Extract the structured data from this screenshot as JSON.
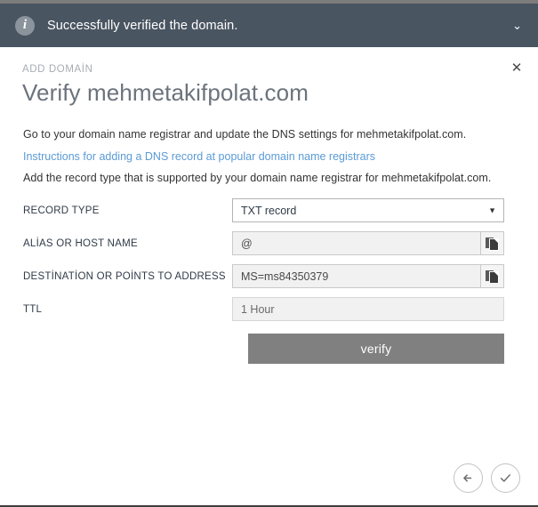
{
  "notification": {
    "icon": "info-icon",
    "message": "Successfully verified the domain.",
    "chevron": "⌄",
    "background_color": "#4a5562"
  },
  "panel": {
    "close_label": "✕",
    "eyebrow": "ADD DOMAİN",
    "title": "Verify mehmetakifpolat.com",
    "paragraph_1": "Go to your domain name registrar and update the DNS settings for mehmetakifpolat.com.",
    "link_text": "Instructions for adding a DNS record at popular domain name registrars",
    "link_color": "#5b9bd5",
    "paragraph_2": "Add the record type that is supported by your domain name registrar for mehmetakifpolat.com."
  },
  "form": {
    "fields": [
      {
        "label": "RECORD TYPE",
        "type": "select",
        "value": "TXT record",
        "options": [
          "TXT record"
        ],
        "has_copy": false,
        "arrow": "▼"
      },
      {
        "label": "ALİAS OR HOST NAME",
        "type": "text",
        "value": "@",
        "has_copy": true
      },
      {
        "label": "DESTİNATİON OR POİNTS TO ADDRESS",
        "type": "text",
        "value": "MS=ms84350379",
        "has_copy": true
      },
      {
        "label": "TTL",
        "type": "text",
        "value": "1 Hour",
        "has_copy": false
      }
    ],
    "submit_label": "verify",
    "submit_color": "#808080"
  },
  "footer": {
    "back_label": "back",
    "confirm_label": "confirm"
  }
}
